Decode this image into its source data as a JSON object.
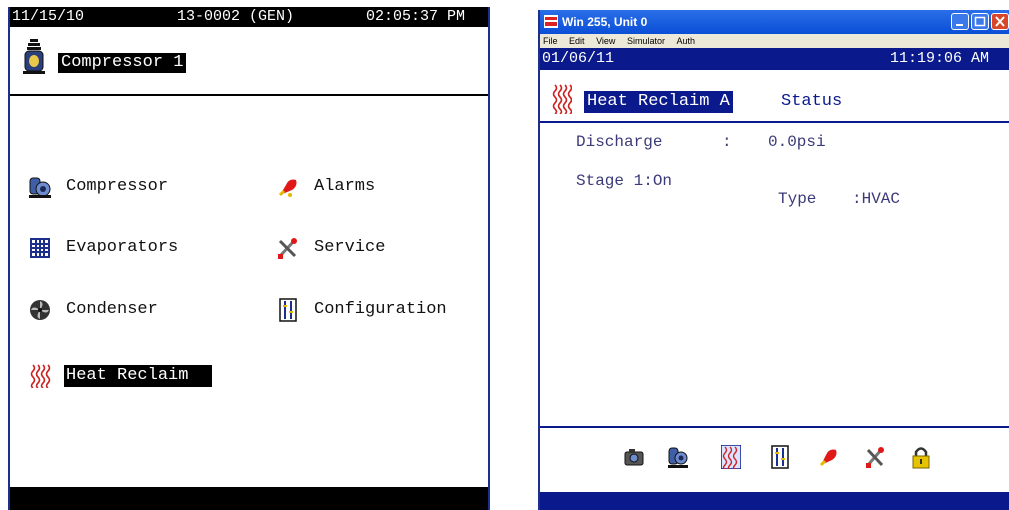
{
  "left": {
    "date": "11/15/10",
    "unit": "13-0002 (GEN)",
    "time": "02:05:37 PM",
    "title": "Compressor 1",
    "menu": {
      "compressor": "Compressor",
      "alarms": "Alarms",
      "evaporators": "Evaporators",
      "service": "Service",
      "condenser": "Condenser",
      "configuration": "Configuration",
      "heat_reclaim": "Heat Reclaim"
    }
  },
  "right": {
    "window_title": "Win 255, Unit 0",
    "menu": [
      "File",
      "Edit",
      "View",
      "Simulator",
      "Auth"
    ],
    "date": "01/06/11",
    "time": "11:19:06 AM",
    "screen_title": "Heat Reclaim A",
    "screen_subtitle": "Status",
    "discharge_label": "Discharge",
    "discharge_sep": ":",
    "discharge_value": "0.0psi",
    "stage": "Stage 1:On",
    "type_label": "Type",
    "type_value": ":HVAC"
  },
  "colors": {
    "accent_navy": "#0a1a8c",
    "heat_red": "#cc2222",
    "alarm_red": "#e01818"
  }
}
